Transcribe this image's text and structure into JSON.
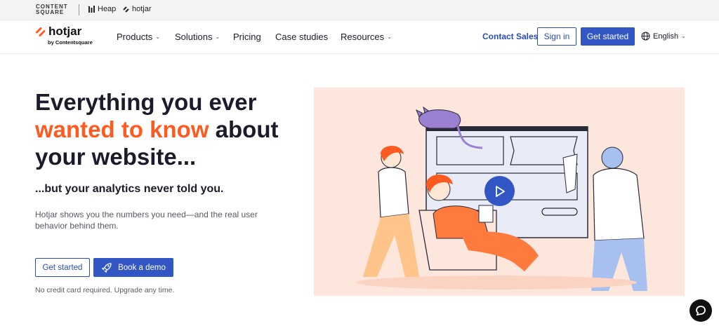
{
  "topbar": {
    "contentsquare_line1": "CONTENT",
    "contentsquare_line2": "SQUARE",
    "heap": "Heap",
    "hotjar": "hotjar"
  },
  "nav": {
    "logo": "hotjar",
    "logo_sub": "by Contentsquare",
    "items": [
      {
        "label": "Products"
      },
      {
        "label": "Solutions"
      },
      {
        "label": "Pricing"
      },
      {
        "label": "Case studies"
      },
      {
        "label": "Resources"
      }
    ],
    "contact_sales": "Contact Sales",
    "sign_in": "Sign in",
    "get_started": "Get started",
    "language": "English"
  },
  "hero": {
    "headline_part1": "Everything you ever",
    "headline_accent": "wanted to know",
    "headline_part2": "about your website...",
    "subheadline": "...but your analytics never told you.",
    "description": "Hotjar shows you the numbers you need—and the real user behavior behind them.",
    "get_started": "Get started",
    "book_demo": "Book a demo",
    "note": "No credit card required. Upgrade any time."
  },
  "colors": {
    "accent": "#ff5a1f",
    "primary": "#3256c4",
    "hero_bg": "#fde6dc"
  }
}
